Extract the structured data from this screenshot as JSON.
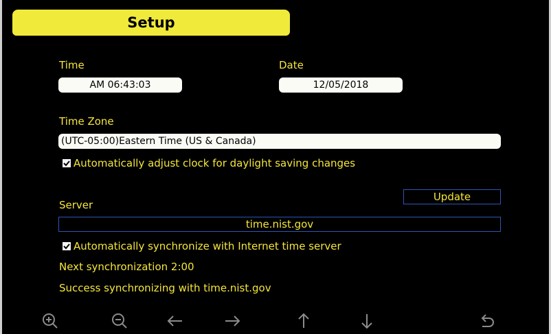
{
  "header": {
    "title": "Setup"
  },
  "time": {
    "label": "Time",
    "value": "AM 06:43:03"
  },
  "date": {
    "label": "Date",
    "value": "12/05/2018"
  },
  "timezone": {
    "label": "Time Zone",
    "value": "(UTC-05:00)Eastern Time (US & Canada)",
    "dst_checkbox_label": "Automatically adjust clock for daylight saving changes",
    "dst_checked": true
  },
  "server": {
    "label": "Server",
    "update_label": "Update",
    "value": "time.nist.gov",
    "sync_checkbox_label": "Automatically synchronize with Internet time server",
    "sync_checked": true,
    "next_sync_text": "Next synchronization 2:00",
    "status_text": "Success synchronizing with time.nist.gov"
  },
  "toolbar": {
    "icons": [
      "zoom-in-icon",
      "zoom-out-icon",
      "arrow-left-icon",
      "arrow-right-icon",
      "arrow-up-icon",
      "arrow-down-icon",
      "undo-icon"
    ]
  },
  "colors": {
    "accent": "#f0ea3a",
    "text": "#f5e63c",
    "background": "#000000",
    "field_bg": "#fbfbf6",
    "outline": "#2d56b8",
    "icon_gray": "#8c8c8c"
  }
}
